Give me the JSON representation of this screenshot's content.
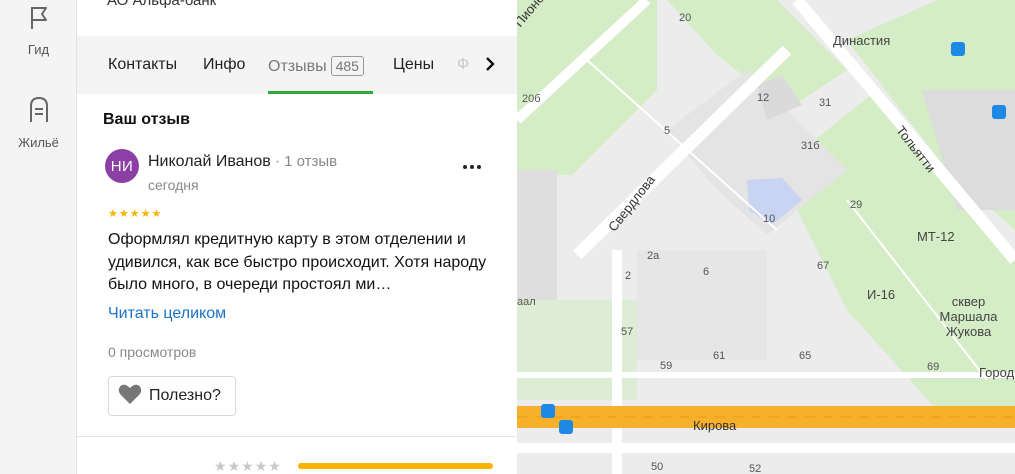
{
  "rail": {
    "items": [
      {
        "label": "Гид",
        "icon": "flag-icon"
      },
      {
        "label": "Жильё",
        "icon": "building-icon"
      }
    ]
  },
  "panel": {
    "subtitle": "АО Альфа-банк",
    "tabs": [
      {
        "label": "Контакты"
      },
      {
        "label": "Инфо"
      },
      {
        "label": "Отзывы",
        "count": "485",
        "active": true
      },
      {
        "label": "Цены"
      },
      {
        "label": "Ф"
      }
    ],
    "section_title": "Ваш отзыв",
    "review": {
      "avatar_initials": "НИ",
      "avatar_color": "#8c3fa5",
      "author": "Николай Иванов",
      "reviews_count": "1 отзыв",
      "date": "сегодня",
      "rating": 5,
      "text": "Оформлял кредитную карту в этом отделении и удивился, как все быстро происходит. Хотя народу было много, в очереди простоял ми…",
      "read_more": "Читать целиком",
      "views": "0 просмотров",
      "useful_label": "Полезно?"
    },
    "rating_bar_fill": 1.0
  },
  "map": {
    "streets": [
      {
        "name": "Пионерский"
      },
      {
        "name": "Свердлова"
      },
      {
        "name": "Тольятти"
      },
      {
        "name": "Кирова"
      }
    ],
    "places": [
      {
        "name": "Династия"
      },
      {
        "name": "МТ-12"
      },
      {
        "name": "И-16"
      },
      {
        "name": "сквер Маршала Жукова"
      },
      {
        "name": "Город"
      }
    ],
    "house_numbers": [
      "20",
      "20б",
      "12",
      "31",
      "31б",
      "5",
      "10",
      "29",
      "2а",
      "6",
      "67",
      "2",
      "57",
      "61",
      "65",
      "59",
      "69",
      "50",
      "52",
      "аал"
    ],
    "colors": {
      "accent": "#2eaa36",
      "road_main": "#f7b02c",
      "park": "#d4edc6",
      "block": "#e6e6e6"
    }
  }
}
